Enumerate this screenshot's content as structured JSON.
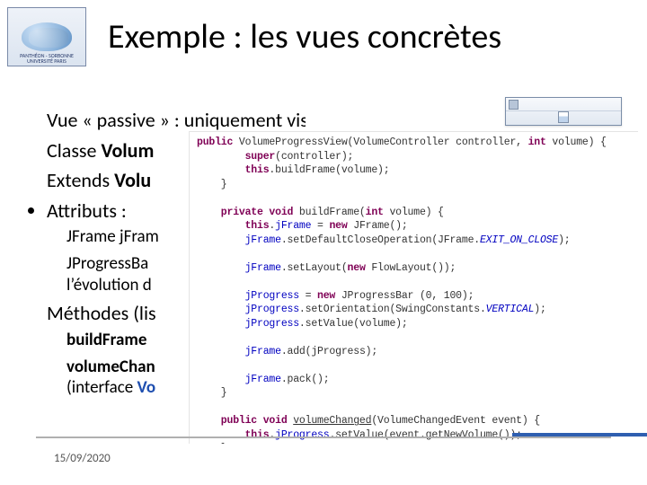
{
  "logo": {
    "line1": "PANTHÉON - SORBONNE",
    "line2": "UNIVERSITÉ PARIS"
  },
  "title": "Exemple : les vues concrètes",
  "bullets": {
    "b1_pre": "Vue « passive » : uniquement visualisation",
    "b2_pre": "Classe ",
    "b2_kw": "Volum",
    "b3_pre": "Extends ",
    "b3_kw": "Volu",
    "b4": "Attributs :",
    "sub1": "JFrame jFram",
    "sub2a": "JProgressBa",
    "sub2b": "l’évolution d",
    "b5": "Méthodes (lis",
    "sub3": "buildFrame",
    "sub4a": "volumeChan",
    "sub4b_pre": "(interface ",
    "sub4b_kw": "Vo"
  },
  "footer": {
    "date": "15/09/2020"
  },
  "code": {
    "l01_a": "public",
    "l01_b": " VolumeProgressView(VolumeController controller, ",
    "l01_c": "int",
    "l01_d": " volume) {",
    "l02_a": "        super",
    "l02_b": "(controller);",
    "l03_a": "        this",
    "l03_b": ".buildFrame(volume);",
    "l04": "    }",
    "l05": "",
    "l06_a": "    private void",
    "l06_b": " buildFrame(",
    "l06_c": "int",
    "l06_d": " volume) {",
    "l07_a": "        this",
    "l07_b": ".",
    "l07_c": "jFrame",
    "l07_d": " = ",
    "l07_e": "new",
    "l07_f": " JFrame();",
    "l08_a": "        jFrame",
    "l08_b": ".setDefaultCloseOperation(JFrame.",
    "l08_c": "EXIT_ON_CLOSE",
    "l08_d": ");",
    "l09": "",
    "l10_a": "        jFrame",
    "l10_b": ".setLayout(",
    "l10_c": "new",
    "l10_d": " FlowLayout());",
    "l11": "",
    "l12_a": "        jProgress",
    "l12_b": " = ",
    "l12_c": "new",
    "l12_d": " JProgressBar (0, 100);",
    "l13_a": "        jProgress",
    "l13_b": ".setOrientation(SwingConstants.",
    "l13_c": "VERTICAL",
    "l13_d": ");",
    "l14_a": "        jProgress",
    "l14_b": ".setValue(volume);",
    "l15": "",
    "l16_a": "        jFrame",
    "l16_b": ".add(jProgress);",
    "l17": "",
    "l18_a": "        jFrame",
    "l18_b": ".pack();",
    "l19": "    }",
    "l20": "",
    "l21_a": "    public void ",
    "l21_b": "volumeChanged",
    "l21_c": "(VolumeChangedEvent event) {",
    "l22_a": "        this",
    "l22_b": ".",
    "l22_c": "jProgress",
    "l22_d": ".setValue(event.getNewVolume());",
    "l23": "    }",
    "l24": "}"
  }
}
